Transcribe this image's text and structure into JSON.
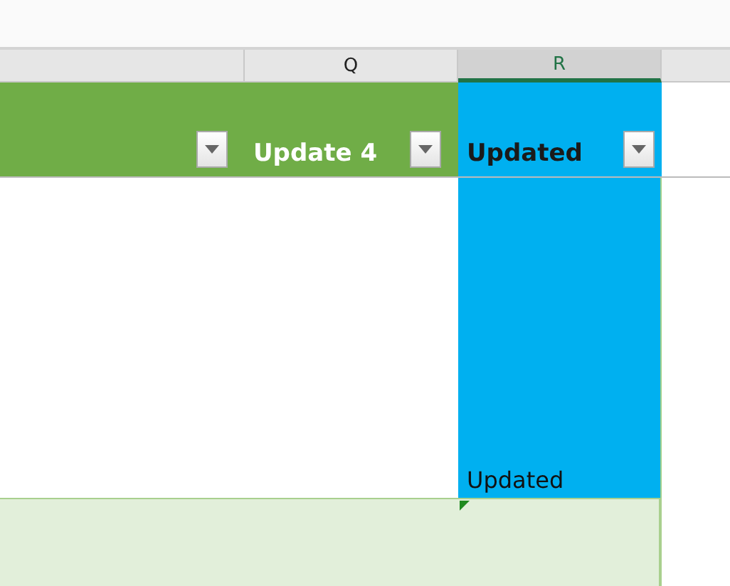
{
  "column_headers": [
    {
      "label": "Q",
      "selected": false
    },
    {
      "label": "R",
      "selected": true
    }
  ],
  "header_cells": [
    {
      "color": "#70ad47",
      "filter": true
    },
    {
      "text": "Update 4",
      "color": "#70ad47",
      "filter": true
    },
    {
      "text": "Updated",
      "color": "#00b0f0",
      "filter": true
    }
  ],
  "data_cell": {
    "text": "Updated",
    "color": "#00b0f0"
  },
  "bottom_row": {
    "color": "#e2efda",
    "comment_marker": true
  }
}
